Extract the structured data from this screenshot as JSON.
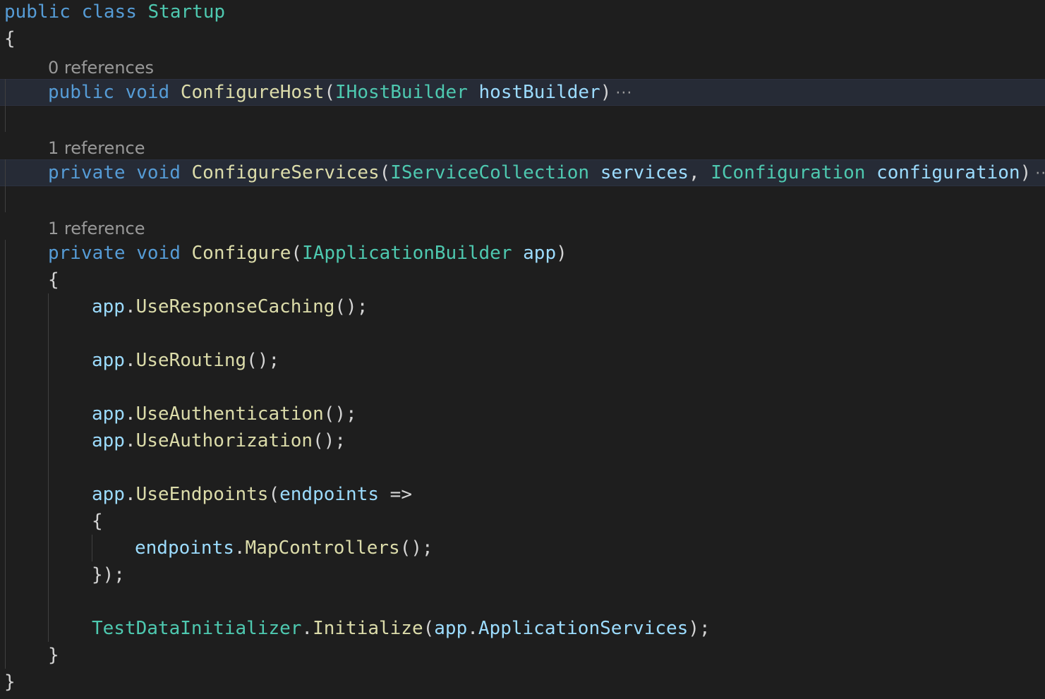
{
  "colors": {
    "background": "#1e1e1e",
    "keyword": "#569cd6",
    "type": "#4ec9b0",
    "method": "#dcdcaa",
    "identifier": "#9cdcfe",
    "punctuation": "#d4d4d4",
    "codelens": "#999999",
    "folded_highlight": "#262b36"
  },
  "code": {
    "class_decl": {
      "kw1": "public",
      "kw2": "class",
      "name": "Startup"
    },
    "open_brace": "{",
    "close_brace": "}",
    "configure_host": {
      "references": "0 references",
      "kw1": "public",
      "kw2": "void",
      "name": "ConfigureHost",
      "open_paren": "(",
      "param_type": "IHostBuilder",
      "param_name": "hostBuilder",
      "close_paren": ")",
      "ellipsis": "···"
    },
    "configure_services": {
      "references": "1 reference",
      "kw1": "private",
      "kw2": "void",
      "name": "ConfigureServices",
      "open_paren": "(",
      "param1_type": "IServiceCollection",
      "param1_name": "services",
      "comma": ",",
      "param2_type": "IConfiguration",
      "param2_name": "configuration",
      "close_paren": ")",
      "ellipsis": "···"
    },
    "configure": {
      "references": "1 reference",
      "kw1": "private",
      "kw2": "void",
      "name": "Configure",
      "open_paren": "(",
      "param_type": "IApplicationBuilder",
      "param_name": "app",
      "close_paren": ")",
      "open_brace": "{",
      "close_brace": "}"
    },
    "body": {
      "app": "app",
      "dot": ".",
      "call_end": "();",
      "use_response_caching": "UseResponseCaching",
      "use_routing": "UseRouting",
      "use_authentication": "UseAuthentication",
      "use_authorization": "UseAuthorization",
      "use_endpoints": "UseEndpoints",
      "endpoints_open": "(",
      "endpoints_param": "endpoints",
      "arrow": "=>",
      "lambda_open": "{",
      "endpoints_obj": "endpoints",
      "map_controllers": "MapControllers",
      "lambda_close": "});",
      "initializer_class": "TestDataInitializer",
      "initialize": "Initialize",
      "init_open": "(",
      "app_services": "ApplicationServices",
      "init_close": ");"
    }
  }
}
